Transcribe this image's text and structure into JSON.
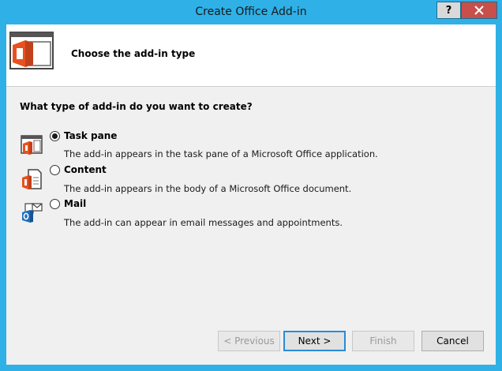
{
  "window": {
    "title": "Create Office Add-in"
  },
  "titlebar": {
    "help_label": "?",
    "close_label": "X"
  },
  "header": {
    "title": "Choose the add-in type"
  },
  "question": "What type of add-in do you want to create?",
  "options": [
    {
      "label": "Task pane",
      "description": "The add-in appears in the task pane of a Microsoft Office application.",
      "selected": true,
      "icon": "task-pane-icon"
    },
    {
      "label": "Content",
      "description": "The add-in appears in the body of a Microsoft Office document.",
      "selected": false,
      "icon": "content-icon"
    },
    {
      "label": "Mail",
      "description": "The add-in can appear in email messages and appointments.",
      "selected": false,
      "icon": "mail-icon"
    }
  ],
  "buttons": {
    "previous": "< Previous",
    "next": "Next >",
    "finish": "Finish",
    "cancel": "Cancel"
  },
  "colors": {
    "titlebar": "#2fb0e6",
    "close": "#c7504b",
    "office_orange": "#e8511e",
    "outlook_blue": "#1f6fc0"
  }
}
